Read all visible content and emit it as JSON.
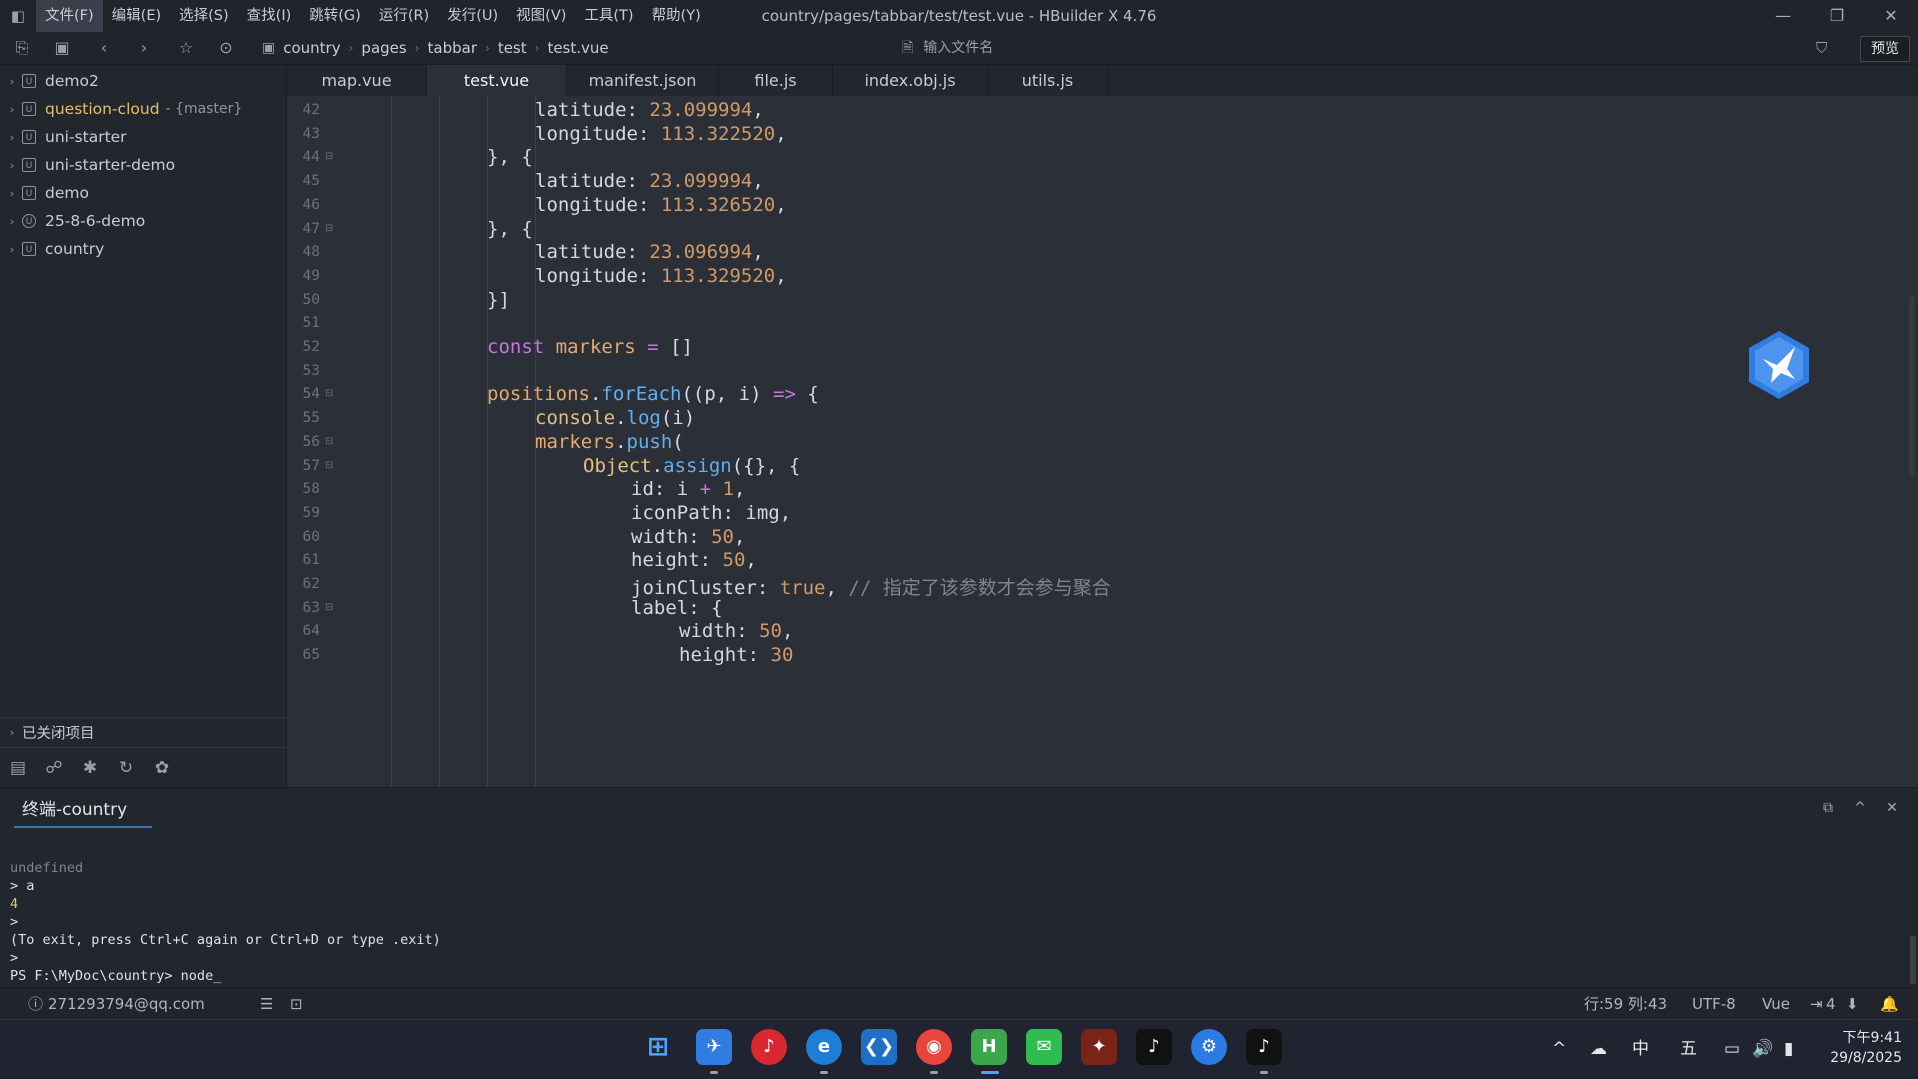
{
  "window": {
    "title": "country/pages/tabbar/test/test.vue - HBuilder X 4.76",
    "menu": [
      "文件(F)",
      "编辑(E)",
      "选择(S)",
      "查找(I)",
      "跳转(G)",
      "运行(R)",
      "发行(U)",
      "视图(V)",
      "工具(T)",
      "帮助(Y)"
    ]
  },
  "toolbar": {
    "breadcrumb": [
      "country",
      "pages",
      "tabbar",
      "test",
      "test.vue"
    ],
    "file_search_placeholder": "输入文件名",
    "preview_label": "预览"
  },
  "sidebar": {
    "projects": [
      {
        "name": "demo2",
        "branch": ""
      },
      {
        "name": "question-cloud",
        "branch": "- {master}"
      },
      {
        "name": "uni-starter",
        "branch": ""
      },
      {
        "name": "uni-starter-demo",
        "branch": ""
      },
      {
        "name": "demo",
        "branch": ""
      },
      {
        "name": "25-8-6-demo",
        "branch": ""
      },
      {
        "name": "country",
        "branch": ""
      }
    ],
    "closed_projects_label": "已关闭项目"
  },
  "tabs": [
    {
      "label": "map.vue",
      "active": false
    },
    {
      "label": "test.vue",
      "active": true
    },
    {
      "label": "manifest.json",
      "active": false
    },
    {
      "label": "file.js",
      "active": false
    },
    {
      "label": "index.obj.js",
      "active": false
    },
    {
      "label": "utils.js",
      "active": false
    }
  ],
  "editor": {
    "line_numbers": [
      "42",
      "43",
      "44",
      "45",
      "46",
      "47",
      "48",
      "49",
      "50",
      "51",
      "52",
      "53",
      "54",
      "55",
      "56",
      "57",
      "58",
      "59",
      "60",
      "61",
      "62",
      "63",
      "64",
      "65"
    ],
    "lines": [
      "latitude: 23.099994,",
      "longitude: 113.322520,",
      "}, {",
      "latitude: 23.099994,",
      "longitude: 113.326520,",
      "}, {",
      "latitude: 23.096994,",
      "longitude: 113.329520,",
      "}]",
      "",
      "const markers = []",
      "",
      "positions.forEach((p, i) => {",
      "console.log(i)",
      "markers.push(",
      "Object.assign({}, {",
      "id: i + 1,",
      "iconPath: img,",
      "width: 50,",
      "height: 50,",
      "joinCluster: true, // 指定了该参数才会参与聚合",
      "label: {",
      "width: 50,",
      "height: 30"
    ]
  },
  "terminal": {
    "tab_label": "终端-country",
    "lines": [
      "undefined",
      "> a",
      "4",
      ">",
      "(To exit, press Ctrl+C again or Ctrl+D or type .exit)",
      ">",
      "PS F:\\MyDoc\\country> node_"
    ]
  },
  "statusbar": {
    "account": "271293794@qq.com",
    "position": "行:59  列:43",
    "encoding": "UTF-8",
    "language": "Vue",
    "indent": "4"
  },
  "taskbar": {
    "tray_ime": "中",
    "tray_day": "五",
    "time": "下午9:41",
    "date": "29/8/2025"
  },
  "colors": {
    "accent": "#3e6fb0",
    "git_project": "#e2c06a",
    "keyword": "#c678dd",
    "variable": "#e5a96b",
    "number": "#d19a66",
    "function": "#61afef"
  }
}
